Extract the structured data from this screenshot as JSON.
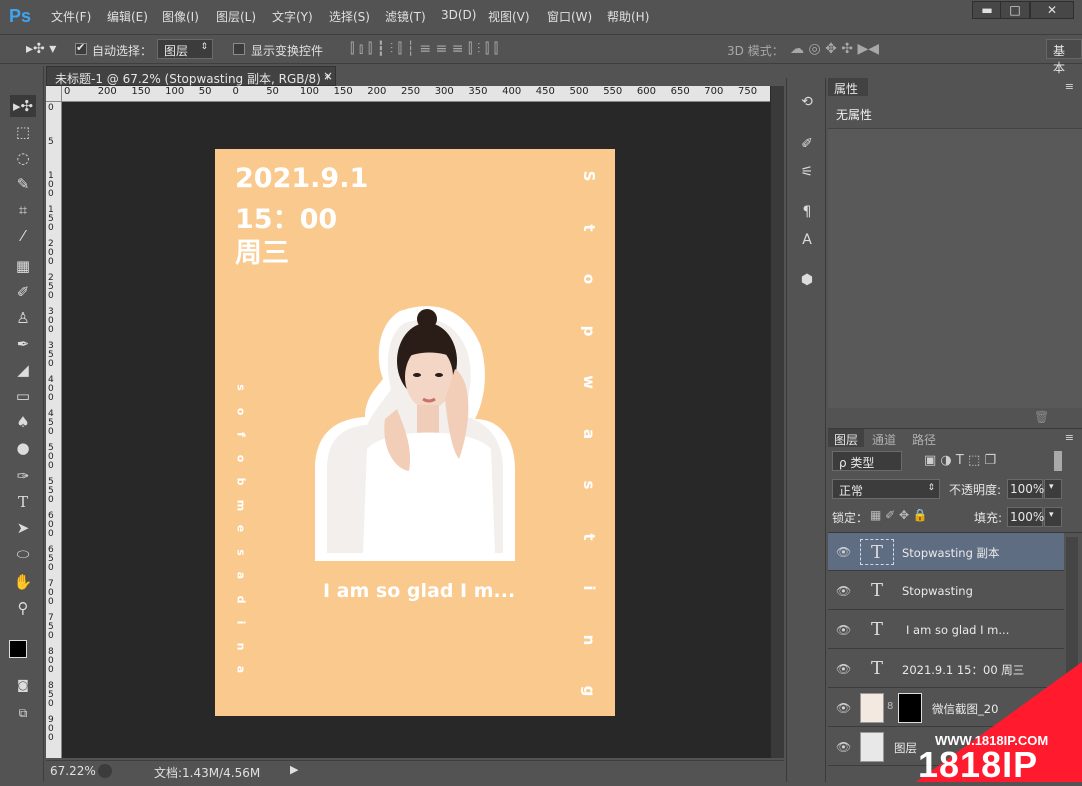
{
  "app": {
    "logo": "Ps"
  },
  "menu": [
    "文件(F)",
    "编辑(E)",
    "图像(I)",
    "图层(L)",
    "文字(Y)",
    "选择(S)",
    "滤镜(T)",
    "3D(D)",
    "视图(V)",
    "窗口(W)",
    "帮助(H)"
  ],
  "window_controls": {
    "minimize": "▬",
    "restore": "□",
    "close": "✕"
  },
  "options": {
    "auto_select_label": "自动选择：",
    "auto_select_value": "图层",
    "show_transform_label": "显示变换控件",
    "mode_3d_label": "3D 模式：",
    "workspace_button": "基本"
  },
  "document": {
    "tab_title": "未标题-1 @ 67.2% (Stopwasting  副本, RGB/8) *",
    "tab_close": "×",
    "ruler_top": [
      "0",
      "200",
      "150",
      "100",
      "50",
      "0",
      "50",
      "100",
      "150",
      "200",
      "250",
      "300",
      "350",
      "400",
      "450",
      "500",
      "550",
      "600",
      "650",
      "700",
      "750",
      "80"
    ],
    "ruler_left": [
      "0",
      "5",
      "1 0 0",
      "1 5 0",
      "2 0 0",
      "2 5 0",
      "3 0 0",
      "3 5 0",
      "4 0 0",
      "4 5 0",
      "5 0 0",
      "5 5 0",
      "6 0 0",
      "6 5 0",
      "7 0 0",
      "7 5 0",
      "8 0 0",
      "8 5 0",
      "9 0 0"
    ]
  },
  "poster": {
    "date": "2021.9.1",
    "time": "15：00",
    "weekday": "周三",
    "tagline": "I am so glad I m...",
    "vertical_right": [
      "S",
      "t",
      "o",
      "p",
      "w",
      "a",
      "s",
      "t",
      "i",
      "n",
      "g"
    ],
    "vertical_left": [
      "s",
      "o",
      "f",
      "o",
      "b",
      "m",
      "e",
      "s",
      "a",
      "d",
      "i",
      "n",
      "a"
    ],
    "background_color": "#f9c98e"
  },
  "status": {
    "zoom": "67.22%",
    "doc_info": "文档:1.43M/4.56M"
  },
  "properties_panel": {
    "tab": "属性",
    "content": "无属性"
  },
  "layers_panel": {
    "tabs": [
      "图层",
      "通道",
      "路径"
    ],
    "filter_label": "ρ 类型",
    "blend_mode": "正常",
    "opacity_label": "不透明度:",
    "opacity_value": "100%",
    "lock_label": "锁定：",
    "fill_label": "填充:",
    "fill_value": "100%",
    "layers": [
      {
        "name": "Stopwasting 副本",
        "type": "text",
        "selected": true
      },
      {
        "name": "Stopwasting",
        "type": "text",
        "selected": false
      },
      {
        "name": "I am so glad I m...",
        "type": "text",
        "selected": false
      },
      {
        "name": "2021.9.1  15：00 周三",
        "type": "text",
        "selected": false
      },
      {
        "name": "微信截图_20",
        "type": "image",
        "selected": false
      },
      {
        "name": "图层",
        "type": "image",
        "selected": false
      }
    ]
  },
  "watermark": {
    "url": "WWW.1818IP.COM",
    "brand": "1818IP"
  },
  "colors": {
    "accent": "#3fa5f2",
    "ui_bg": "#535353",
    "workspace": "#282828",
    "selected_layer": "#5f6d82"
  }
}
